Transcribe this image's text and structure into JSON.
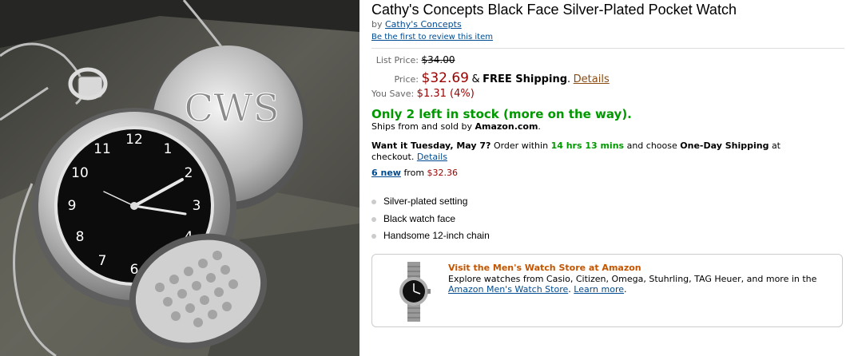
{
  "product": {
    "title": "Cathy's Concepts Black Face Silver-Plated Pocket Watch",
    "by_label": "by",
    "brand": "Cathy's Concepts",
    "review_link": "Be the first to review this item",
    "image_engraving": "CWS"
  },
  "pricing": {
    "list_label": "List Price:",
    "list_price": "$34.00",
    "price_label": "Price:",
    "price": "$32.69",
    "amp": "&",
    "free_shipping": "FREE Shipping",
    "period": ".",
    "details_link": "Details",
    "save_label": "You Save:",
    "save_amount": "$1.31 (4%)"
  },
  "availability": {
    "stock": "Only 2 left in stock (more on the way).",
    "ships_prefix": "Ships from and sold by",
    "seller": "Amazon.com",
    "ships_suffix": "."
  },
  "delivery": {
    "want": "Want it Tuesday, May 7?",
    "order_within": "Order within",
    "time": "14 hrs 13 mins",
    "and_choose": "and choose",
    "one_day": "One-Day Shipping",
    "at_checkout": "at checkout.",
    "details_link": "Details"
  },
  "offers": {
    "new_link": "6 new",
    "from": "from",
    "from_price": "$32.36"
  },
  "bullets": [
    "Silver-plated setting",
    "Black watch face",
    "Handsome 12-inch chain"
  ],
  "promo": {
    "title": "Visit the Men's Watch Store at Amazon",
    "text": "Explore watches from Casio, Citizen, Omega, Stuhrling, TAG Heuer, and more in the",
    "store_link": "Amazon Men's Watch Store",
    "period": ".",
    "learn_more": "Learn more",
    "learn_period": "."
  },
  "colors": {
    "price_red": "#990000",
    "stock_green": "#009900",
    "link_blue": "#004b91",
    "promo_orange": "#c45500"
  }
}
